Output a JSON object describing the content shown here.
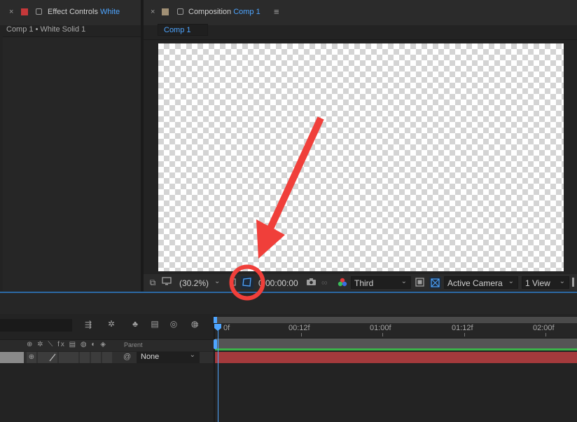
{
  "effect_panel": {
    "title_prefix": "Effect Controls",
    "title_highlight": "White",
    "breadcrumb": "Comp 1 • White Solid 1",
    "swatch_color": "#c5383a"
  },
  "comp_panel": {
    "title_prefix": "Composition",
    "title_highlight": "Comp 1",
    "tab": "Comp 1",
    "swatch_color": "#a08f74"
  },
  "viewer_toolbar": {
    "zoom": "(30.2%)",
    "timecode": "0:00:00:00",
    "resolution": "Third",
    "camera": "Active Camera",
    "views": "1 View"
  },
  "timeline": {
    "ruler_ticks": [
      "0f",
      "00:12f",
      "01:00f",
      "01:12f",
      "02:00f"
    ],
    "columns": {
      "parent": "Parent"
    },
    "layer": {
      "parent_value": "None"
    }
  },
  "annotation": {
    "arrow_color": "#f03f3a",
    "circle_color": "#f03f3a"
  }
}
